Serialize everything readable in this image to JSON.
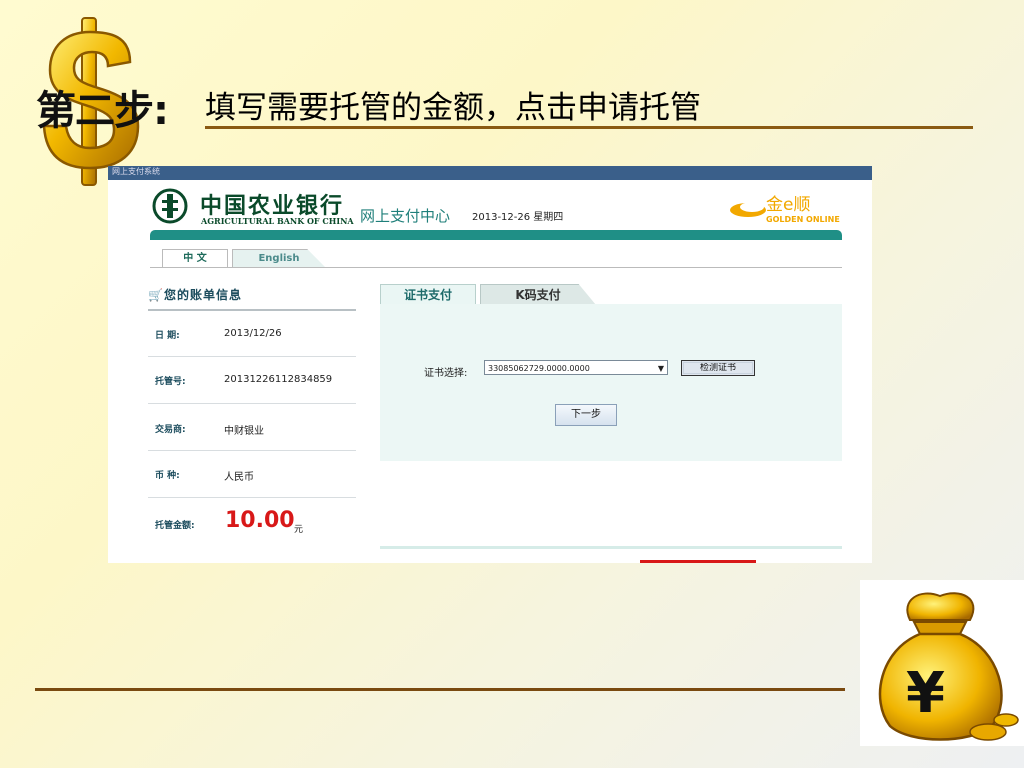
{
  "slide": {
    "step_title": "第二步:",
    "step_subtitle": "填写需要托管的金额，点击申请托管"
  },
  "browser": {
    "title_text": "网上支付系统"
  },
  "bank": {
    "name_cn": "中国农业银行",
    "name_en": "AGRICULTURAL BANK OF CHINA",
    "pay_center": "网上支付中心",
    "date": "2013-12-26 星期四",
    "partner_logo_cn": "金e顺",
    "partner_logo_en": "GOLDEN ONLINE"
  },
  "lang_tabs": [
    "中 文",
    "English"
  ],
  "bill": {
    "header": "您的账单信息",
    "rows": [
      {
        "label": "日  期:",
        "value": "2013/12/26"
      },
      {
        "label": "托管号:",
        "value": "20131226112834859"
      },
      {
        "label": "交易商:",
        "value": "中财银业"
      },
      {
        "label": "币  种:",
        "value": "人民币"
      }
    ],
    "amount_label": "托管金额:",
    "amount": "10.00",
    "amount_unit": "元"
  },
  "payment": {
    "tabs": [
      "证书支付",
      "K码支付"
    ],
    "cert_label": "证书选择:",
    "cert_value": "33085062729.0000.0000",
    "detect_button": "检测证书",
    "next_button": "下一步"
  },
  "colors": {
    "bank_green": "#1f8f86",
    "amount_red": "#d81818",
    "rule_brown": "#8a5a12"
  }
}
